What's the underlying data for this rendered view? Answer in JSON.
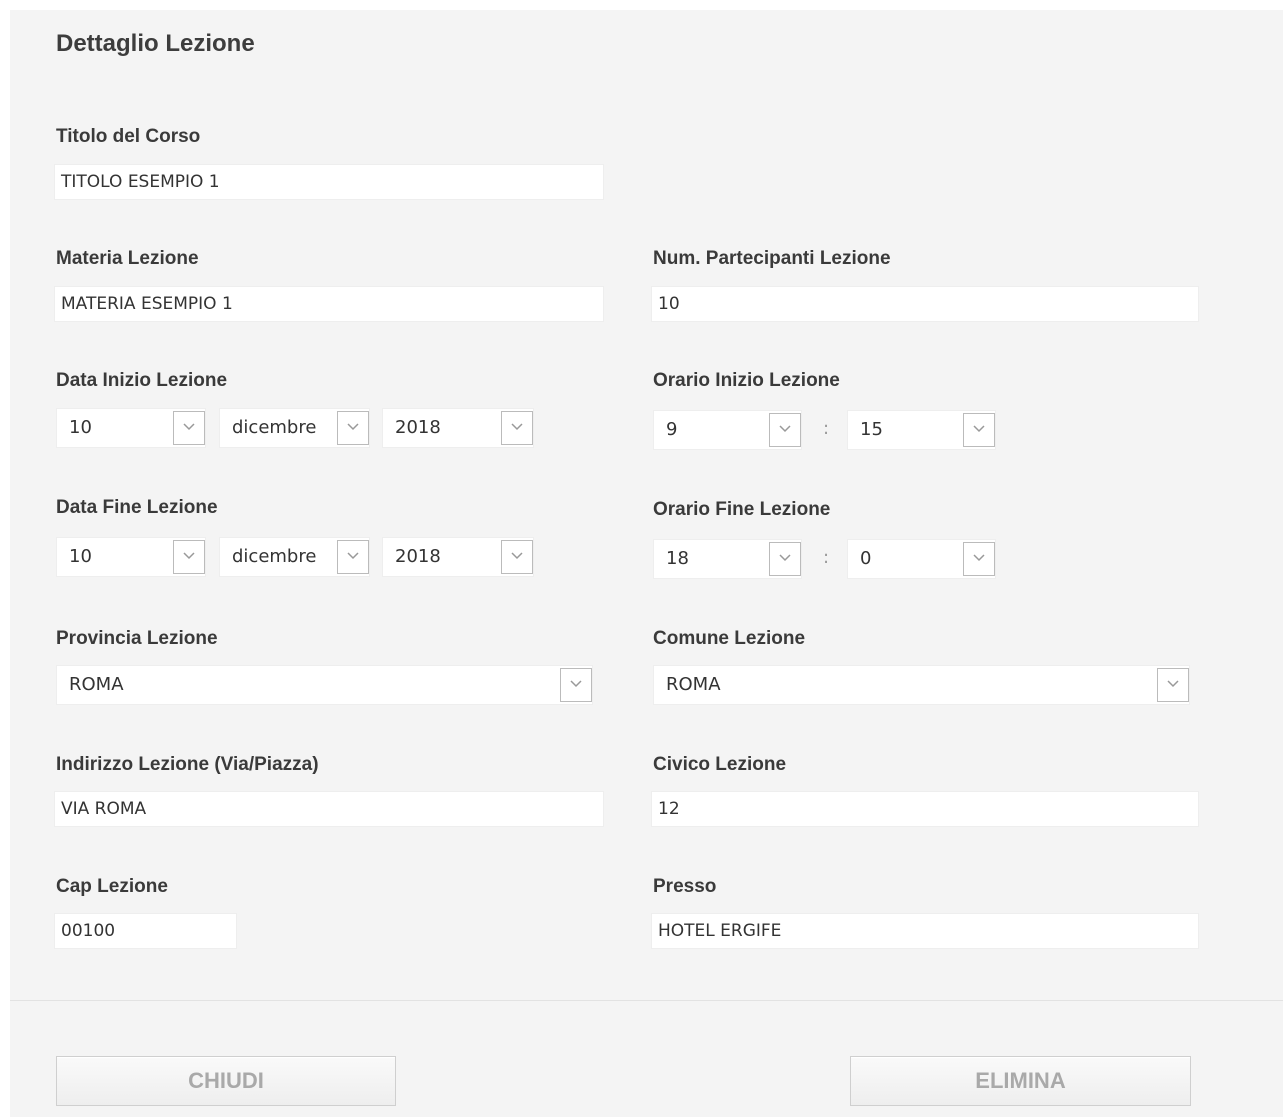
{
  "title": "Dettaglio Lezione",
  "fields": {
    "titolo_corso": {
      "label": "Titolo del Corso",
      "value": "TITOLO ESEMPIO 1"
    },
    "materia": {
      "label": "Materia Lezione",
      "value": "MATERIA ESEMPIO 1"
    },
    "num_partecipanti": {
      "label": "Num. Partecipanti Lezione",
      "value": "10"
    },
    "data_inizio": {
      "label": "Data Inizio Lezione",
      "day": "10",
      "month": "dicembre",
      "year": "2018"
    },
    "orario_inizio": {
      "label": "Orario Inizio Lezione",
      "hour": "9",
      "minute": "15",
      "separator": ":"
    },
    "data_fine": {
      "label": "Data Fine Lezione",
      "day": "10",
      "month": "dicembre",
      "year": "2018"
    },
    "orario_fine": {
      "label": "Orario Fine Lezione",
      "hour": "18",
      "minute": "0",
      "separator": ":"
    },
    "provincia": {
      "label": "Provincia Lezione",
      "value": "ROMA"
    },
    "comune": {
      "label": "Comune Lezione",
      "value": "ROMA"
    },
    "indirizzo": {
      "label": "Indirizzo Lezione (Via/Piazza)",
      "value": "VIA ROMA"
    },
    "civico": {
      "label": "Civico Lezione",
      "value": "12"
    },
    "cap": {
      "label": "Cap Lezione",
      "value": "00100"
    },
    "presso": {
      "label": "Presso",
      "value": "HOTEL ERGIFE"
    }
  },
  "buttons": {
    "close": "CHIUDI",
    "delete": "ELIMINA"
  },
  "icons": {
    "dropdown": "chevron-down-icon"
  }
}
